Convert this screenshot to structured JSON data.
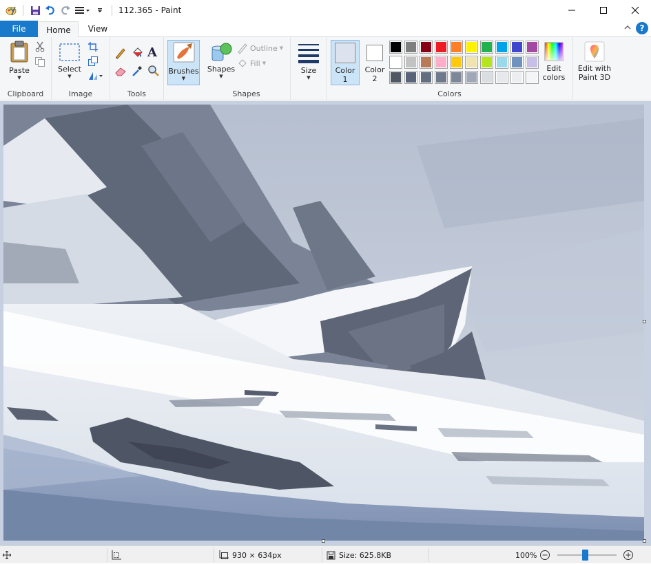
{
  "window": {
    "title": "112.365 - Paint"
  },
  "tabs": {
    "file": "File",
    "home": "Home",
    "view": "View"
  },
  "clipboard": {
    "paste_label": "Paste",
    "group_label": "Clipboard"
  },
  "image": {
    "select_label": "Select",
    "group_label": "Image"
  },
  "tools": {
    "group_label": "Tools"
  },
  "brushes": {
    "label": "Brushes"
  },
  "shapes": {
    "label": "Shapes",
    "outline_label": "Outline",
    "fill_label": "Fill",
    "group_label": "Shapes"
  },
  "size": {
    "label": "Size"
  },
  "colors": {
    "color1_label": "Color\n1",
    "color1_line1": "Color",
    "color1_line2": "1",
    "color2_line1": "Color",
    "color2_line2": "2",
    "color1_value": "#dde3ee",
    "color2_value": "#ffffff",
    "group_label": "Colors",
    "edit_line1": "Edit",
    "edit_line2": "colors",
    "palette": [
      [
        "#000000",
        "#7f7f7f",
        "#880015",
        "#ed1c24",
        "#ff7f27",
        "#fff200",
        "#22b14c",
        "#00a2e8",
        "#3f48cc",
        "#a349a4"
      ],
      [
        "#ffffff",
        "#c3c3c3",
        "#b97a57",
        "#ffaec9",
        "#ffc90e",
        "#efe4b0",
        "#b5e61d",
        "#99d9ea",
        "#7092be",
        "#c8bfe7"
      ],
      [
        "#505864",
        "#5a6478",
        "#636e80",
        "#6e7a8c",
        "#7c889a",
        "#a0a8b8",
        "#dadde2",
        "#e6e8ec",
        "#eceef1",
        "#f4f5f7"
      ]
    ]
  },
  "paint3d": {
    "line1": "Edit with",
    "line2": "Paint 3D"
  },
  "status": {
    "dimensions": "930 × 634px",
    "size": "Size: 625.8KB",
    "zoom": "100%",
    "zoom_fraction": 0.47
  }
}
